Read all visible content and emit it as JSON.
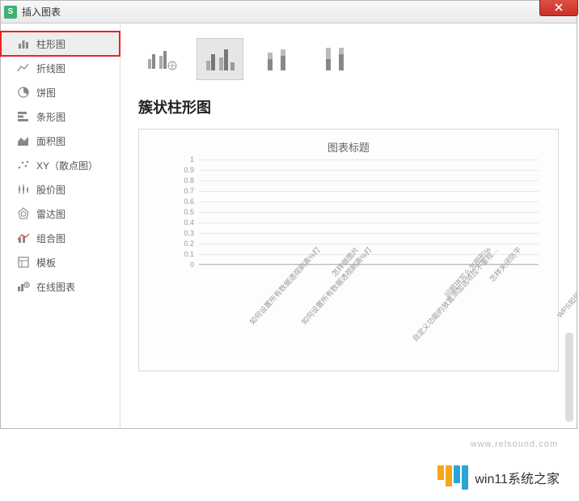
{
  "titlebar": {
    "app_icon_letter": "S",
    "title": "插入图表"
  },
  "sidebar": {
    "items": [
      {
        "id": "bar",
        "label": "柱形图"
      },
      {
        "id": "line",
        "label": "折线图"
      },
      {
        "id": "pie",
        "label": "饼图"
      },
      {
        "id": "hbar",
        "label": "条形图"
      },
      {
        "id": "area",
        "label": "面积图"
      },
      {
        "id": "scatter",
        "label": "XY（散点图）"
      },
      {
        "id": "stock",
        "label": "股价图"
      },
      {
        "id": "radar",
        "label": "雷达图"
      },
      {
        "id": "combo",
        "label": "组合图"
      },
      {
        "id": "template",
        "label": "模板"
      },
      {
        "id": "online",
        "label": "在线图表"
      }
    ]
  },
  "chart_subtype_title": "簇状柱形图",
  "chart_data": {
    "type": "bar",
    "title": "图表标题",
    "ylim": [
      0,
      1
    ],
    "yticks": [
      0,
      0.1,
      0.2,
      0.3,
      0.4,
      0.5,
      0.6,
      0.7,
      0.8,
      0.9,
      1
    ],
    "categories": [
      "如何设置所有数据透视刷高%打",
      "如何设置所有数据透视刷高%打",
      "怎样做图片",
      "自定义功能的放置添加选项应不重视…",
      "问题拼写么怎图形%",
      "怎样关闭防平",
      "WPS如何打开wps文件格式?"
    ],
    "values": [
      0,
      0,
      0,
      0,
      0,
      0,
      0
    ]
  },
  "watermark": "www.relsound.com",
  "branding": {
    "text": "win11系统之家"
  }
}
